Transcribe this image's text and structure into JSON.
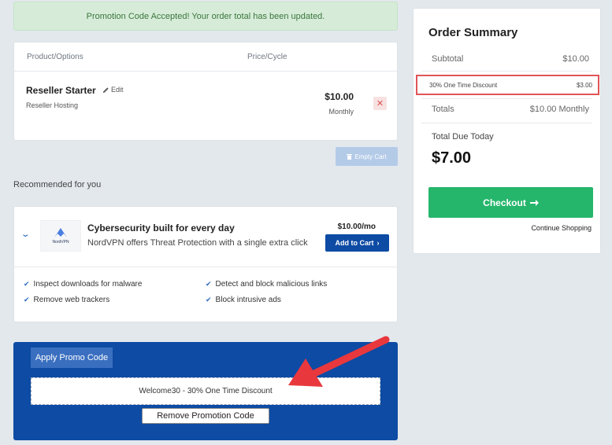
{
  "alert": {
    "text": "Promotion Code Accepted! Your order total has been updated."
  },
  "cart": {
    "headers": {
      "product": "Product/Options",
      "price": "Price/Cycle"
    },
    "item": {
      "name": "Reseller Starter",
      "edit_label": "Edit",
      "group": "Reseller Hosting",
      "price": "$10.00",
      "cycle": "Monthly"
    },
    "empty_cart_label": "Empty Cart"
  },
  "recommended": {
    "title": "Recommended for you",
    "product": {
      "logo_text": "NordVPN",
      "headline": "Cybersecurity built for every day",
      "description": "NordVPN offers Threat Protection with a single extra click",
      "price": "$10.00/mo",
      "add_label": "Add to Cart"
    },
    "features": [
      "Inspect downloads for malware",
      "Detect and block malicious links",
      "Remove web trackers",
      "Block intrusive ads"
    ]
  },
  "promo": {
    "tab_label": "Apply Promo Code",
    "applied_code": "Welcome30 - 30% One Time Discount",
    "remove_label": "Remove Promotion Code"
  },
  "summary": {
    "title": "Order Summary",
    "subtotal_label": "Subtotal",
    "subtotal_value": "$10.00",
    "discount_label": "30% One Time Discount",
    "discount_value": "$3.00",
    "totals_label": "Totals",
    "totals_value": "$10.00 Monthly",
    "due_label": "Total Due Today",
    "due_value": "$7.00",
    "checkout_label": "Checkout",
    "continue_label": "Continue Shopping"
  },
  "colors": {
    "primary_blue": "#0d4ba4",
    "success_green": "#25b66b",
    "highlight_red": "#e15558",
    "annotation_arrow": "#e8383d"
  }
}
